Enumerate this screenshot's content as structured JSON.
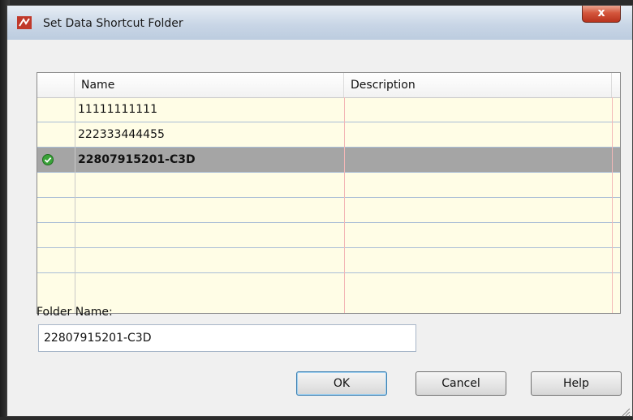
{
  "window": {
    "title": "Set Data Shortcut Folder",
    "close_label": "x"
  },
  "grid": {
    "columns": [
      "Name",
      "Description"
    ],
    "rows": [
      {
        "name": "11111111111",
        "description": "",
        "current": false
      },
      {
        "name": "222333444455",
        "description": "",
        "current": false
      },
      {
        "name": "22807915201-C3D",
        "description": "",
        "current": true
      }
    ],
    "empty_rows": 4
  },
  "folder": {
    "label": "Folder Name:",
    "value": "22807915201-C3D"
  },
  "buttons": {
    "ok": "OK",
    "cancel": "Cancel",
    "help": "Help"
  },
  "colors": {
    "grid_background": "#fffde6",
    "selected_row": "#a5a5a5",
    "check_green": "#3aa339",
    "close_red": "#c9432b"
  }
}
